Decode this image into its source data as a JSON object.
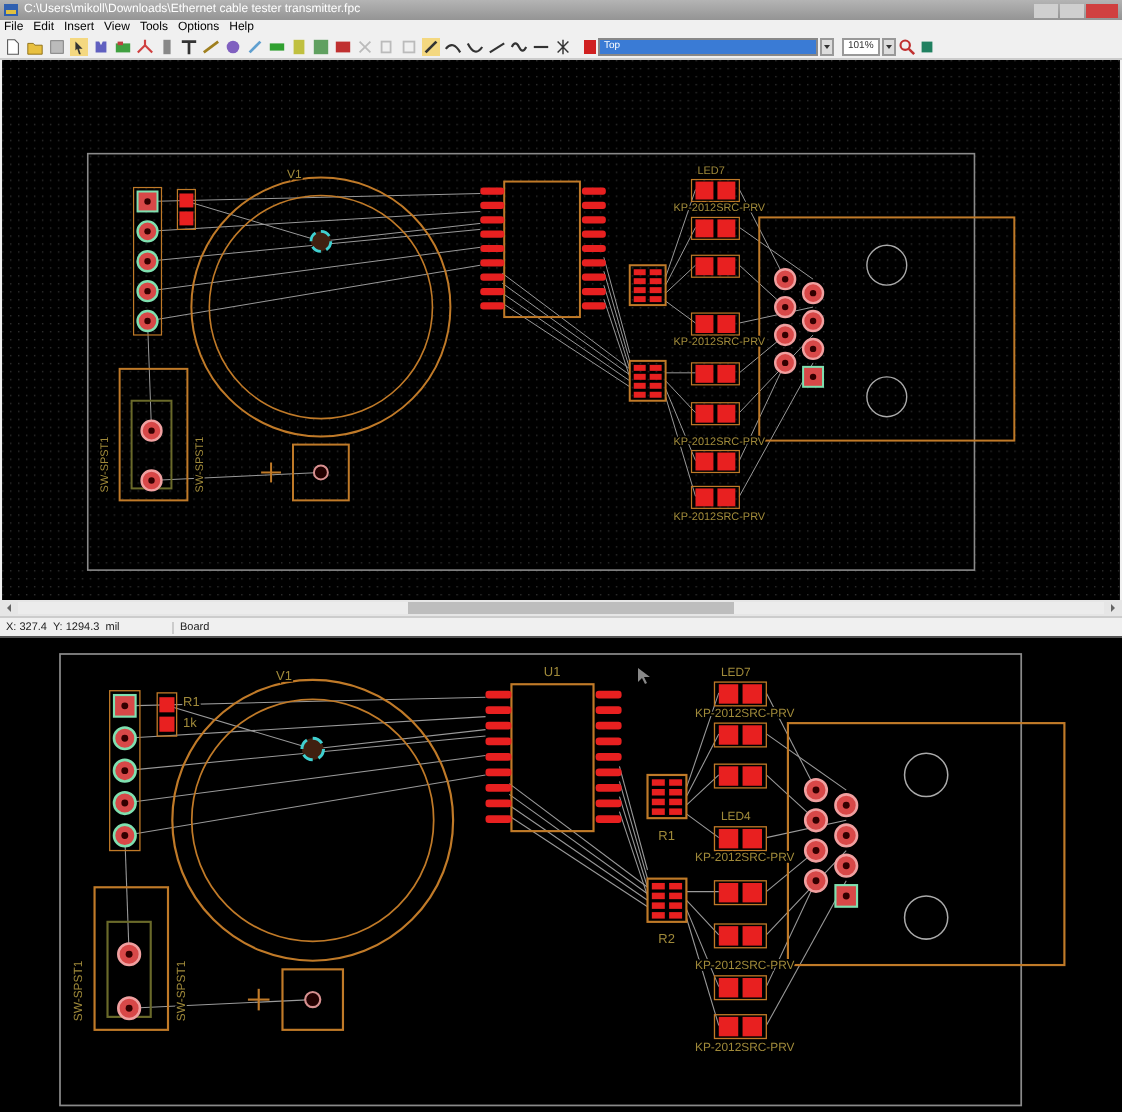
{
  "window": {
    "title": "C:\\Users\\mikoll\\Downloads\\Ethernet cable tester transmitter.fpc"
  },
  "menu": [
    "File",
    "Edit",
    "Insert",
    "View",
    "Tools",
    "Options",
    "Help"
  ],
  "toolbar": {
    "layer": "Top",
    "zoom": "101%"
  },
  "status_bar": {
    "coordinates": "X: 327.4  Y: 1294.3  mil",
    "mode": "Board"
  },
  "top_view": {
    "battery_ref": "V1",
    "led_refs": [
      "LED7"
    ],
    "switch_refs": [
      "SW-SPST1",
      "SW-SPST1"
    ],
    "led_values": [
      "KP-2012SRC-PRV",
      "KP-2012SRC-PRV",
      "KP-2012SRC-PRV",
      "KP-2012SRC-PRV"
    ]
  },
  "lower_view": {
    "battery_ref": "V1",
    "resistor_ref": "R1",
    "resistor_value": "1k",
    "ic_ref": "U1",
    "led_refs": [
      "LED7",
      "LED4"
    ],
    "array_refs": [
      "R1",
      "R2"
    ],
    "switch_refs": [
      "SW-SPST1",
      "SW-SPST1"
    ],
    "led_values": [
      "KP-2012SRC-PRV",
      "KP-2012SRC-PRV",
      "KP-2012SRC-PRV",
      "KP-2012SRC-PRV"
    ]
  }
}
